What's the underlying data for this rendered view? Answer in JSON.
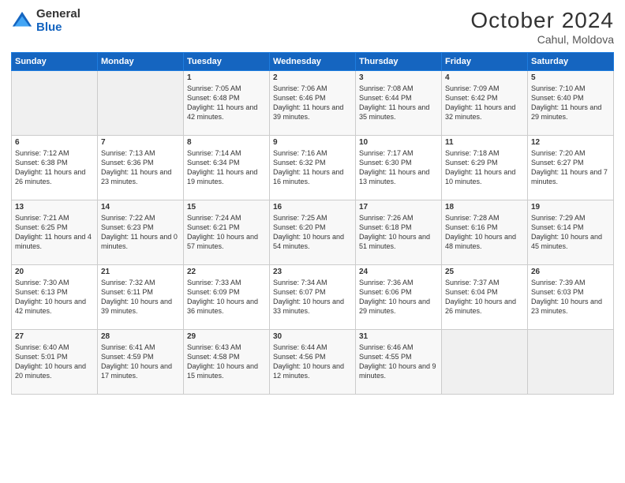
{
  "logo": {
    "general": "General",
    "blue": "Blue"
  },
  "header": {
    "month": "October 2024",
    "location": "Cahul, Moldova"
  },
  "weekdays": [
    "Sunday",
    "Monday",
    "Tuesday",
    "Wednesday",
    "Thursday",
    "Friday",
    "Saturday"
  ],
  "weeks": [
    [
      {
        "day": "",
        "empty": true
      },
      {
        "day": "",
        "empty": true
      },
      {
        "day": "1",
        "sunrise": "Sunrise: 7:05 AM",
        "sunset": "Sunset: 6:48 PM",
        "daylight": "Daylight: 11 hours and 42 minutes."
      },
      {
        "day": "2",
        "sunrise": "Sunrise: 7:06 AM",
        "sunset": "Sunset: 6:46 PM",
        "daylight": "Daylight: 11 hours and 39 minutes."
      },
      {
        "day": "3",
        "sunrise": "Sunrise: 7:08 AM",
        "sunset": "Sunset: 6:44 PM",
        "daylight": "Daylight: 11 hours and 35 minutes."
      },
      {
        "day": "4",
        "sunrise": "Sunrise: 7:09 AM",
        "sunset": "Sunset: 6:42 PM",
        "daylight": "Daylight: 11 hours and 32 minutes."
      },
      {
        "day": "5",
        "sunrise": "Sunrise: 7:10 AM",
        "sunset": "Sunset: 6:40 PM",
        "daylight": "Daylight: 11 hours and 29 minutes."
      }
    ],
    [
      {
        "day": "6",
        "sunrise": "Sunrise: 7:12 AM",
        "sunset": "Sunset: 6:38 PM",
        "daylight": "Daylight: 11 hours and 26 minutes."
      },
      {
        "day": "7",
        "sunrise": "Sunrise: 7:13 AM",
        "sunset": "Sunset: 6:36 PM",
        "daylight": "Daylight: 11 hours and 23 minutes."
      },
      {
        "day": "8",
        "sunrise": "Sunrise: 7:14 AM",
        "sunset": "Sunset: 6:34 PM",
        "daylight": "Daylight: 11 hours and 19 minutes."
      },
      {
        "day": "9",
        "sunrise": "Sunrise: 7:16 AM",
        "sunset": "Sunset: 6:32 PM",
        "daylight": "Daylight: 11 hours and 16 minutes."
      },
      {
        "day": "10",
        "sunrise": "Sunrise: 7:17 AM",
        "sunset": "Sunset: 6:30 PM",
        "daylight": "Daylight: 11 hours and 13 minutes."
      },
      {
        "day": "11",
        "sunrise": "Sunrise: 7:18 AM",
        "sunset": "Sunset: 6:29 PM",
        "daylight": "Daylight: 11 hours and 10 minutes."
      },
      {
        "day": "12",
        "sunrise": "Sunrise: 7:20 AM",
        "sunset": "Sunset: 6:27 PM",
        "daylight": "Daylight: 11 hours and 7 minutes."
      }
    ],
    [
      {
        "day": "13",
        "sunrise": "Sunrise: 7:21 AM",
        "sunset": "Sunset: 6:25 PM",
        "daylight": "Daylight: 11 hours and 4 minutes."
      },
      {
        "day": "14",
        "sunrise": "Sunrise: 7:22 AM",
        "sunset": "Sunset: 6:23 PM",
        "daylight": "Daylight: 11 hours and 0 minutes."
      },
      {
        "day": "15",
        "sunrise": "Sunrise: 7:24 AM",
        "sunset": "Sunset: 6:21 PM",
        "daylight": "Daylight: 10 hours and 57 minutes."
      },
      {
        "day": "16",
        "sunrise": "Sunrise: 7:25 AM",
        "sunset": "Sunset: 6:20 PM",
        "daylight": "Daylight: 10 hours and 54 minutes."
      },
      {
        "day": "17",
        "sunrise": "Sunrise: 7:26 AM",
        "sunset": "Sunset: 6:18 PM",
        "daylight": "Daylight: 10 hours and 51 minutes."
      },
      {
        "day": "18",
        "sunrise": "Sunrise: 7:28 AM",
        "sunset": "Sunset: 6:16 PM",
        "daylight": "Daylight: 10 hours and 48 minutes."
      },
      {
        "day": "19",
        "sunrise": "Sunrise: 7:29 AM",
        "sunset": "Sunset: 6:14 PM",
        "daylight": "Daylight: 10 hours and 45 minutes."
      }
    ],
    [
      {
        "day": "20",
        "sunrise": "Sunrise: 7:30 AM",
        "sunset": "Sunset: 6:13 PM",
        "daylight": "Daylight: 10 hours and 42 minutes."
      },
      {
        "day": "21",
        "sunrise": "Sunrise: 7:32 AM",
        "sunset": "Sunset: 6:11 PM",
        "daylight": "Daylight: 10 hours and 39 minutes."
      },
      {
        "day": "22",
        "sunrise": "Sunrise: 7:33 AM",
        "sunset": "Sunset: 6:09 PM",
        "daylight": "Daylight: 10 hours and 36 minutes."
      },
      {
        "day": "23",
        "sunrise": "Sunrise: 7:34 AM",
        "sunset": "Sunset: 6:07 PM",
        "daylight": "Daylight: 10 hours and 33 minutes."
      },
      {
        "day": "24",
        "sunrise": "Sunrise: 7:36 AM",
        "sunset": "Sunset: 6:06 PM",
        "daylight": "Daylight: 10 hours and 29 minutes."
      },
      {
        "day": "25",
        "sunrise": "Sunrise: 7:37 AM",
        "sunset": "Sunset: 6:04 PM",
        "daylight": "Daylight: 10 hours and 26 minutes."
      },
      {
        "day": "26",
        "sunrise": "Sunrise: 7:39 AM",
        "sunset": "Sunset: 6:03 PM",
        "daylight": "Daylight: 10 hours and 23 minutes."
      }
    ],
    [
      {
        "day": "27",
        "sunrise": "Sunrise: 6:40 AM",
        "sunset": "Sunset: 5:01 PM",
        "daylight": "Daylight: 10 hours and 20 minutes."
      },
      {
        "day": "28",
        "sunrise": "Sunrise: 6:41 AM",
        "sunset": "Sunset: 4:59 PM",
        "daylight": "Daylight: 10 hours and 17 minutes."
      },
      {
        "day": "29",
        "sunrise": "Sunrise: 6:43 AM",
        "sunset": "Sunset: 4:58 PM",
        "daylight": "Daylight: 10 hours and 15 minutes."
      },
      {
        "day": "30",
        "sunrise": "Sunrise: 6:44 AM",
        "sunset": "Sunset: 4:56 PM",
        "daylight": "Daylight: 10 hours and 12 minutes."
      },
      {
        "day": "31",
        "sunrise": "Sunrise: 6:46 AM",
        "sunset": "Sunset: 4:55 PM",
        "daylight": "Daylight: 10 hours and 9 minutes."
      },
      {
        "day": "",
        "empty": true
      },
      {
        "day": "",
        "empty": true
      }
    ]
  ]
}
